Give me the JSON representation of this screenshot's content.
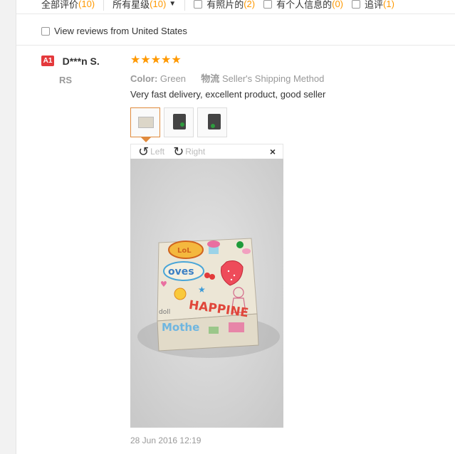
{
  "filters": {
    "all_reviews": {
      "label": "全部评价",
      "count": "(10)"
    },
    "star_select": {
      "label": "所有星级",
      "count": "(10)"
    },
    "with_photos": {
      "label": "有照片的",
      "count": "(2)"
    },
    "with_info": {
      "label": "有个人信息的",
      "count": "(0)"
    },
    "follow_up": {
      "label": "追评",
      "count": "(1)"
    },
    "country_label": "View reviews from United States"
  },
  "review": {
    "badge": "A1",
    "name": "D***n S.",
    "country": "RS",
    "stars": "★★★★★",
    "color_label": "Color:",
    "color_value": "Green",
    "logistics_label": "物流",
    "logistics_value": "Seller's Shipping Method",
    "text": "Very fast delivery, excellent product, good seller",
    "rotate_left": "Left",
    "rotate_right": "Right",
    "close": "×",
    "date": "28 Jun 2016 12:19"
  },
  "photo_text": {
    "loves": "oves",
    "happiness": "HAPPINE",
    "mother": "Mothe",
    "doll": "doll",
    "cloud": "LoL"
  },
  "colors": {
    "accent": "#f90",
    "badge": "#e4393c",
    "thumb_active": "#e08a3c"
  }
}
